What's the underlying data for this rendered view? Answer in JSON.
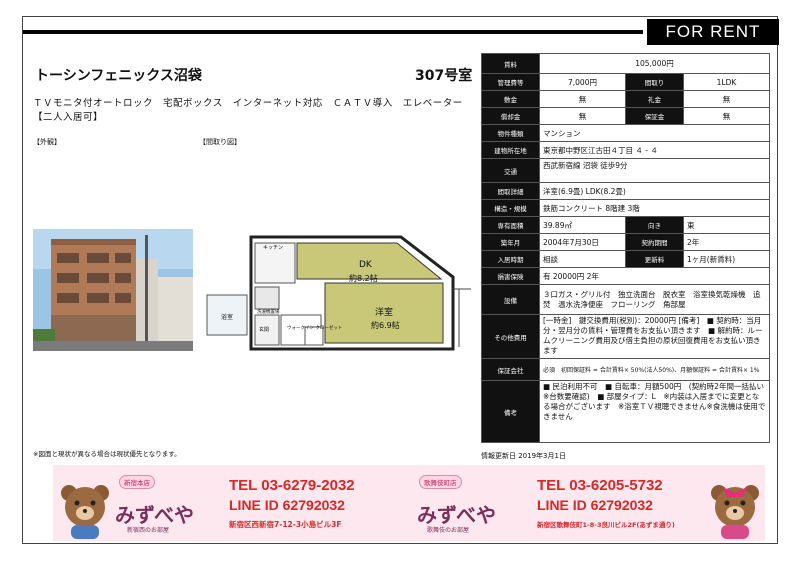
{
  "header": {
    "banner": "FOR RENT"
  },
  "property": {
    "name": "トーシンフェニックス沼袋",
    "room": "307号室",
    "features": "ＴＶモニタ付オートロック　宅配ボックス　インターネット対応　ＣＡＴＶ導入　エレベーター【二人入居可】"
  },
  "labels": {
    "exterior": "【外観】",
    "floorplan": "【間取り図】",
    "note": "※図面と現状が異なる場合は現状優先となります。",
    "updated": "情報更新日 2019年3月1日"
  },
  "floorplan": {
    "dk": "DK",
    "dk_size": "約8.2帖",
    "western": "洋室",
    "western_size": "約6.9帖",
    "kitchen": "キッチン",
    "wash": "洗濯機置場",
    "bath": "浴室",
    "entrance": "玄関",
    "closet": "ウォークイン\nクローゼット"
  },
  "spec": {
    "rent_k": "賃料",
    "rent_v": "105,000円",
    "mgmt_k": "管理費等",
    "mgmt_v": "7,000円",
    "layout_k": "間取り",
    "layout_v": "1LDK",
    "deposit_k": "敷金",
    "deposit_v": "無",
    "key_k": "礼金",
    "key_v": "無",
    "amort_k": "償却金",
    "amort_v": "無",
    "guar_k": "保証金",
    "guar_v": "無",
    "type_k": "物件種類",
    "type_v": "マンション",
    "addr_k": "建物所在地",
    "addr_v": "東京都中野区江古田４丁目 ４ - ４",
    "transit_k": "交通",
    "transit_v": "西武新宿線 沼袋 徒歩9分",
    "detail_k": "間取詳細",
    "detail_v": "洋室(6.9畳) LDK(8.2畳)",
    "struct_k": "構造・規模",
    "struct_v": "鉄筋コンクリート 8階建 3階",
    "area_k": "専有面積",
    "area_v": "39.89㎡",
    "dir_k": "向き",
    "dir_v": "東",
    "built_k": "築年月",
    "built_v": "2004年7月30日",
    "term_k": "契約期間",
    "term_v": "2年",
    "move_k": "入居時期",
    "move_v": "相談",
    "renew_k": "更新料",
    "renew_v": "1ヶ月(新賃料)",
    "ins_k": "損害保険",
    "ins_v": "有 20000円 2年",
    "equip_k": "設備",
    "equip_v": "３口ガス・グリル付　独立洗面台　脱衣室　浴室換気乾燥機　追焚　温水洗浄便座　フローリング　角部屋",
    "other_k": "その他費用",
    "other_v": "[一時金]　鍵交換費用(税別)：20000円 [備考]　■ 契約時：当月分・翌月分の賃料・管理費をお支払い頂きます　■ 解約時：ルームクリーニング費用及び借主負担の原状回復費用をお支払い頂きます",
    "gc_k": "保証会社",
    "gc_v": "必須　初回保証料 = 合計賃料× 50%(法人50%)、月額保証料 = 合計賃料× 1%",
    "remark_k": "備考",
    "remark_v": "■ 民泊利用不可　■ 自転車：月額500円　(契約時2年間一括払い※台数要確認)　■ 部屋タイプ：L　※内装は入居までに変更となる場合がございます　※浴室ＴＶ視聴できません※食洗機は使用できません"
  },
  "ads": [
    {
      "brand": "みずべや",
      "badge": "新宿本店",
      "sub": "新宿西のお部屋",
      "tel": "TEL 03-6279-2032",
      "line": "LINE ID 62792032",
      "addr": "新宿区西新宿7-12-3小島ビル3F"
    },
    {
      "brand": "みずべや",
      "badge": "歌舞伎町店",
      "sub": "歌舞伎のお部屋",
      "tel": "TEL 03-6205-5732",
      "line": "LINE ID 62792032",
      "addr": "新宿区歌舞伎町1-8-3良川ビル2F(あずま通り)"
    }
  ]
}
